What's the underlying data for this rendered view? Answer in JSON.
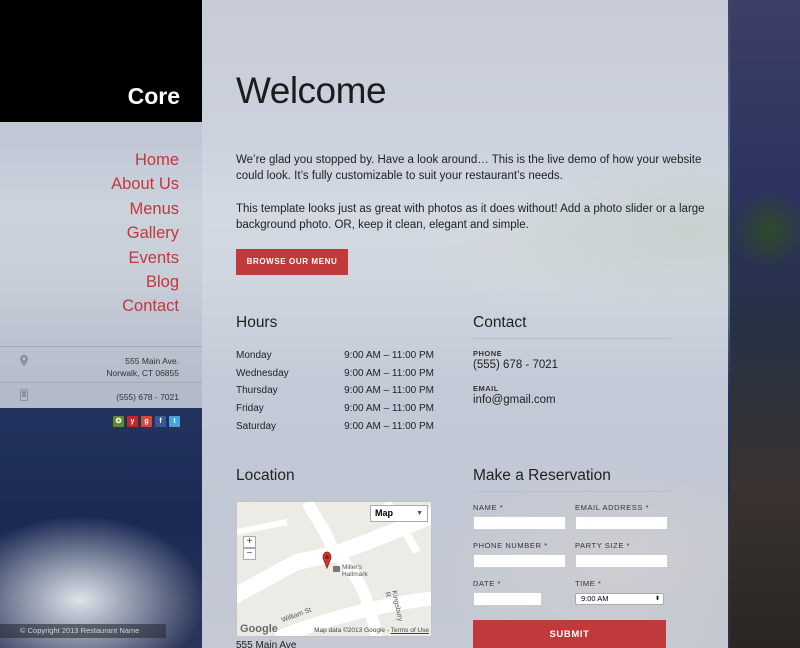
{
  "site": {
    "logo": "Core"
  },
  "nav": {
    "items": [
      "Home",
      "About Us",
      "Menus",
      "Gallery",
      "Events",
      "Blog",
      "Contact"
    ]
  },
  "sidebar": {
    "address_line1": "555 Main Ave.",
    "address_line2": "Norwalk, CT 06855",
    "phone": "(555) 678 - 7021",
    "copyright": "© Copyright 2013 Restaurant Name"
  },
  "main": {
    "title": "Welcome",
    "paragraph1": "We’re glad you stopped by.  Have a look around…  This is the live demo of how your website could look.  It’s fully customizable to suit your restaurant’s needs.",
    "paragraph2": "This template looks just as great with photos as it does without!  Add a photo slider or a large background photo.  OR, keep it clean, elegant and simple.",
    "menu_button": "BROWSE OUR MENU"
  },
  "hours": {
    "title": "Hours",
    "rows": [
      {
        "day": "Monday",
        "time": "9:00 AM – 11:00 PM"
      },
      {
        "day": "Wednesday",
        "time": "9:00 AM – 11:00 PM"
      },
      {
        "day": "Thursday",
        "time": "9:00 AM – 11:00 PM"
      },
      {
        "day": "Friday",
        "time": "9:00 AM – 11:00 PM"
      },
      {
        "day": "Saturday",
        "time": "9:00 AM – 11:00 PM"
      }
    ]
  },
  "contact": {
    "title": "Contact",
    "phone_label": "PHONE",
    "phone": "(555) 678 - 7021",
    "email_label": "EMAIL",
    "email": "info@gmail.com"
  },
  "location": {
    "title": "Location",
    "map_type": "Map",
    "zoom_in": "+",
    "zoom_out": "−",
    "place_name_1": "Miller's",
    "place_name_2": "Hallmark",
    "street_1": "William St",
    "street_2": "Kingsbury R",
    "map_data": "Map data ©2013 Google -",
    "terms": "Terms of Use",
    "google_logo": "Google",
    "address": "555 Main Ave"
  },
  "reservation": {
    "title": "Make a Reservation",
    "name_label": "NAME *",
    "email_label": "EMAIL ADDRESS *",
    "phone_label": "PHONE NUMBER *",
    "party_label": "PARTY SIZE *",
    "date_label": "DATE *",
    "time_label": "TIME *",
    "time_value": "9:00 AM",
    "name_value": "",
    "email_value": "",
    "phone_value": "",
    "party_value": "",
    "date_value": "",
    "submit": "SUBMIT"
  },
  "colors": {
    "accent": "#c0393b",
    "logo_bg": "#000000"
  },
  "icons": {
    "address": "map-pin-icon",
    "phone": "phone-icon"
  }
}
